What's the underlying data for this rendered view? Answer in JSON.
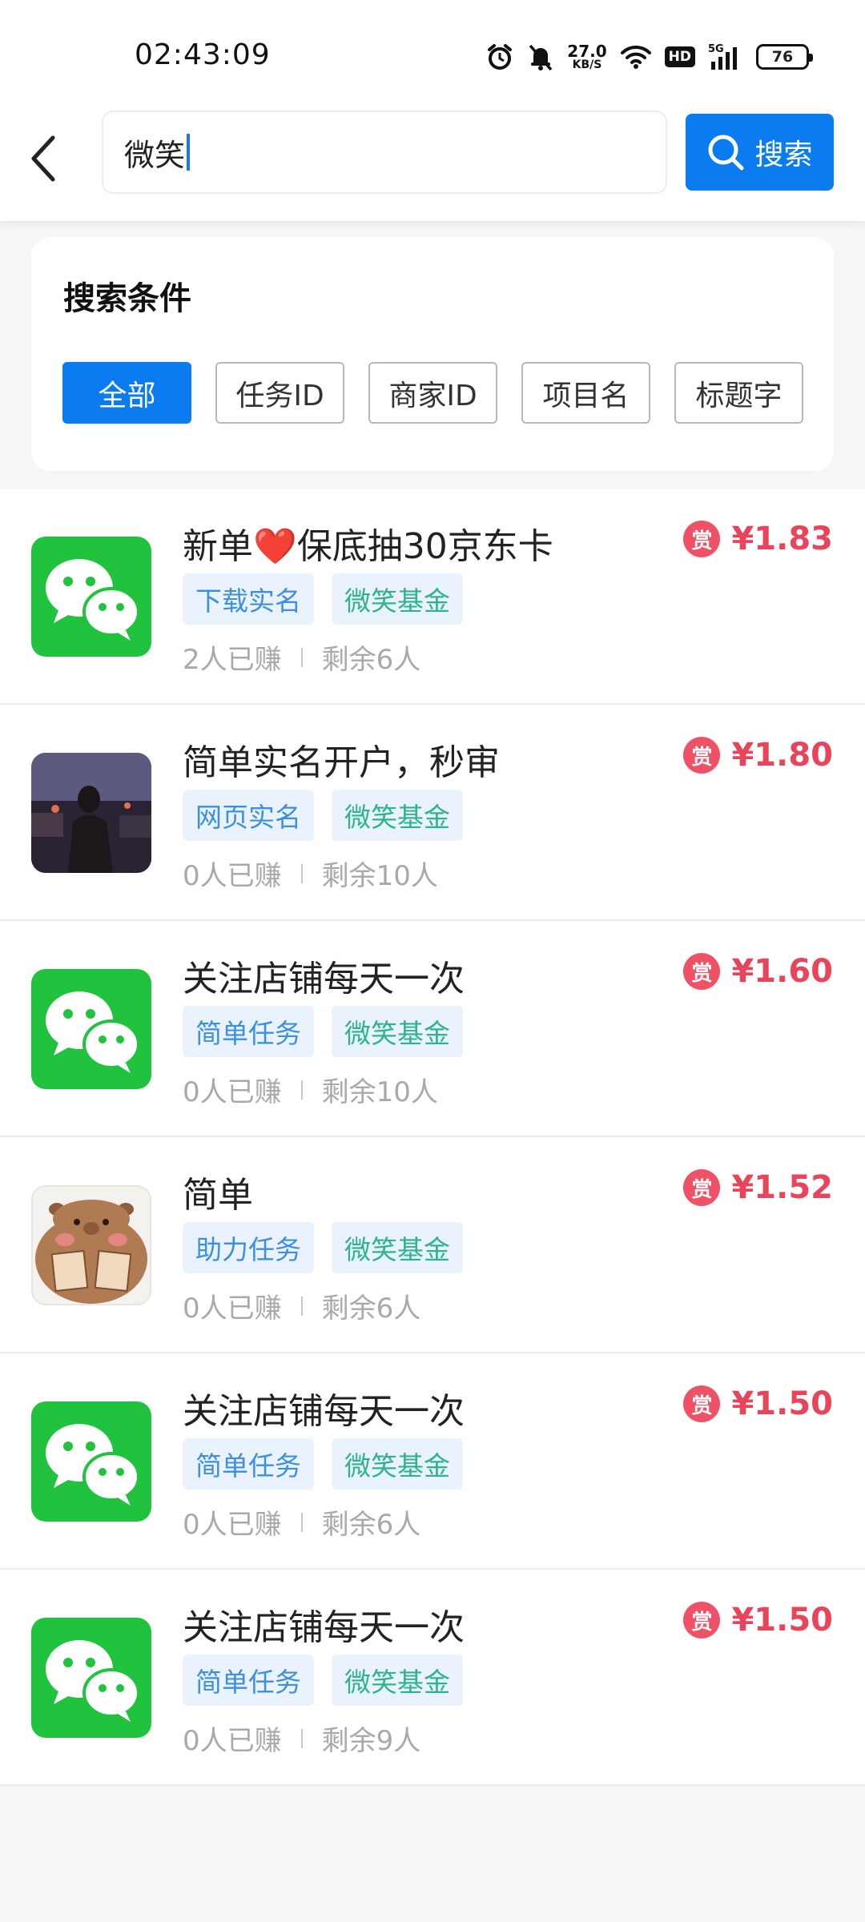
{
  "status_bar": {
    "time": "02:43:09",
    "speed_value": "27.0",
    "speed_unit": "KB/S",
    "hd_label": "HD",
    "network_label": "5G",
    "battery": "76"
  },
  "search": {
    "query": "微笑",
    "button_label": "搜索"
  },
  "filter": {
    "title": "搜索条件",
    "chips": [
      "全部",
      "任务ID",
      "商家ID",
      "项目名",
      "标题字"
    ],
    "active_index": 0
  },
  "tasks": [
    {
      "title_prefix": "新单",
      "title_heart": "❤️",
      "title_suffix": "保底抽30京东卡",
      "tag1": "下载实名",
      "tag2": "微笑基金",
      "earned": "2人已赚",
      "remaining": "剩余6人",
      "badge": "赏",
      "price": "¥1.83",
      "thumb": "wechat"
    },
    {
      "title_prefix": "简单实名开户，秒审",
      "title_heart": "",
      "title_suffix": "",
      "tag1": "网页实名",
      "tag2": "微笑基金",
      "earned": "0人已赚",
      "remaining": "剩余10人",
      "badge": "赏",
      "price": "¥1.80",
      "thumb": "photo"
    },
    {
      "title_prefix": "关注店铺每天一次",
      "title_heart": "",
      "title_suffix": "",
      "tag1": "简单任务",
      "tag2": "微笑基金",
      "earned": "0人已赚",
      "remaining": "剩余10人",
      "badge": "赏",
      "price": "¥1.60",
      "thumb": "wechat"
    },
    {
      "title_prefix": "简单",
      "title_heart": "",
      "title_suffix": "",
      "tag1": "助力任务",
      "tag2": "微笑基金",
      "earned": "0人已赚",
      "remaining": "剩余6人",
      "badge": "赏",
      "price": "¥1.52",
      "thumb": "capy"
    },
    {
      "title_prefix": "关注店铺每天一次",
      "title_heart": "",
      "title_suffix": "",
      "tag1": "简单任务",
      "tag2": "微笑基金",
      "earned": "0人已赚",
      "remaining": "剩余6人",
      "badge": "赏",
      "price": "¥1.50",
      "thumb": "wechat"
    },
    {
      "title_prefix": "关注店铺每天一次",
      "title_heart": "",
      "title_suffix": "",
      "tag1": "简单任务",
      "tag2": "微笑基金",
      "earned": "0人已赚",
      "remaining": "剩余9人",
      "badge": "赏",
      "price": "¥1.50",
      "thumb": "wechat"
    }
  ],
  "colors": {
    "accent": "#0a7cf0",
    "price": "#e8445a",
    "wechat_green": "#20c23e"
  }
}
